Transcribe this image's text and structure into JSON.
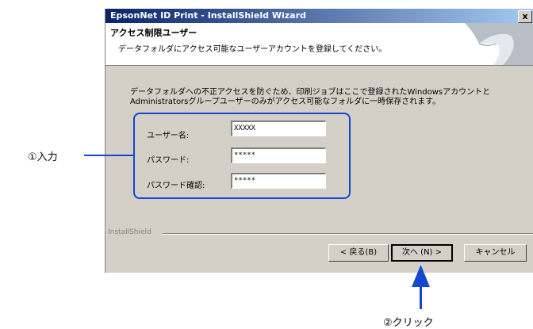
{
  "window": {
    "title": "EpsonNet ID Print - InstallShield Wizard",
    "close_glyph": "x"
  },
  "header": {
    "title": "アクセス制限ユーザー",
    "subtitle": "データフォルダにアクセス可能なユーザーアカウントを登録してください。"
  },
  "description": {
    "line1": "データフォルダへの不正アクセスを防ぐため、印刷ジョブはここで登録されたWindowsアカウントと",
    "line2": "Administratorsグループユーザーのみがアクセス可能なフォルダに一時保存されます。"
  },
  "form": {
    "username_label": "ユーザー名:",
    "username_value": "XXXXX",
    "password_label": "パスワード:",
    "password_value": "*****",
    "confirm_label": "パスワード確認:",
    "confirm_value": "*****"
  },
  "footer": {
    "brand": "InstallShield",
    "back_label": "< 戻る(B)",
    "next_label": "次へ (N) >",
    "cancel_label": "キャンセル"
  },
  "callouts": {
    "input": "①入力",
    "click": "②クリック"
  },
  "colors": {
    "accent": "#1448d0",
    "dialog_bg": "#d4d0c8",
    "titlebar_start": "#0a246a",
    "titlebar_end": "#a6caf0"
  },
  "icons": {
    "header_graphic": "page-curl-graphic",
    "close": "close-icon",
    "arrow": "up-arrow-icon"
  }
}
